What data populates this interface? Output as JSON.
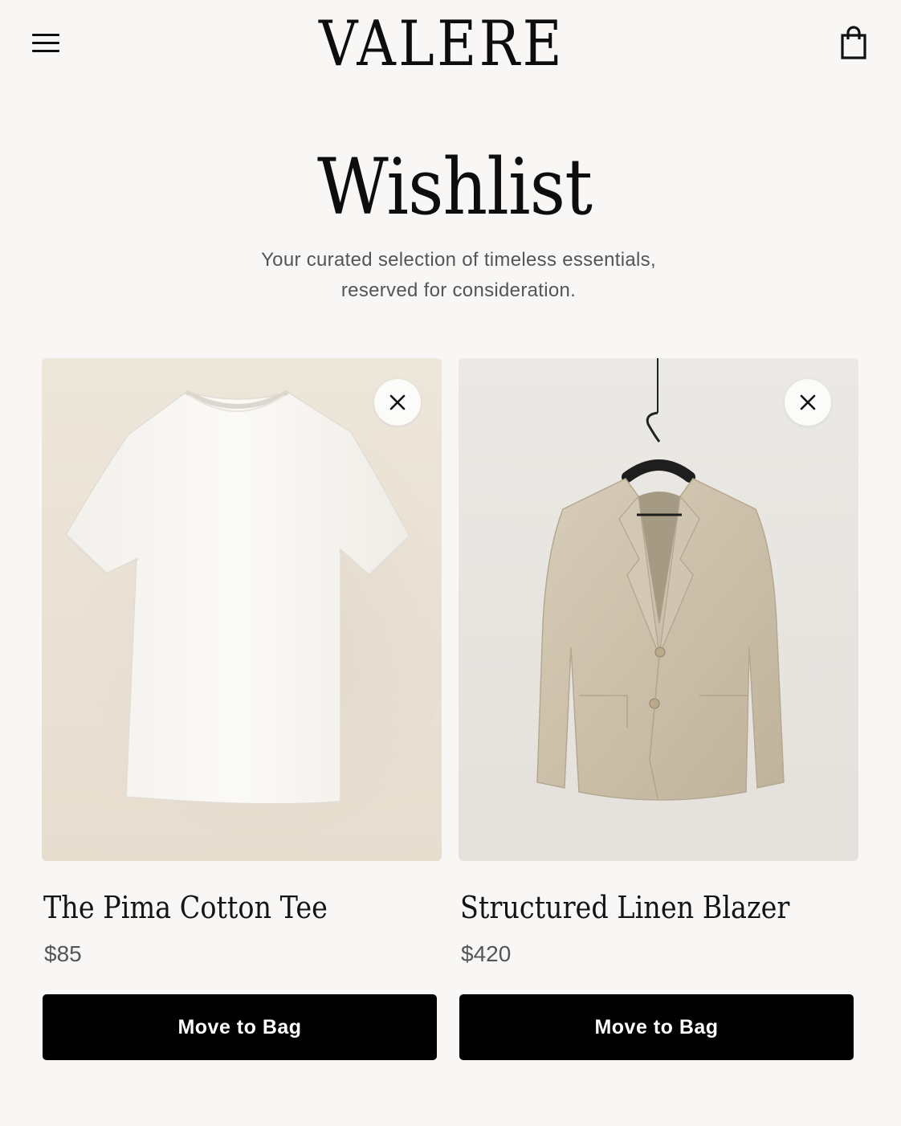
{
  "header": {
    "brand": "VALERE",
    "menu_icon": "hamburger-menu-icon",
    "bag_icon": "shopping-bag-icon"
  },
  "page": {
    "title": "Wishlist",
    "subtitle_line1": "Your curated selection of timeless essentials,",
    "subtitle_line2": "reserved for consideration."
  },
  "items": [
    {
      "name": "The Pima Cotton Tee",
      "price": "$85",
      "action_label": "Move to Bag",
      "image_icon": "white-tshirt-image",
      "remove_icon": "close-icon"
    },
    {
      "name": "Structured Linen Blazer",
      "price": "$420",
      "action_label": "Move to Bag",
      "image_icon": "linen-blazer-on-hanger-image",
      "remove_icon": "close-icon"
    }
  ],
  "colors": {
    "background": "#f8f7f5",
    "button": "#000000",
    "button_text": "#ffffff",
    "muted_text": "#555555"
  }
}
